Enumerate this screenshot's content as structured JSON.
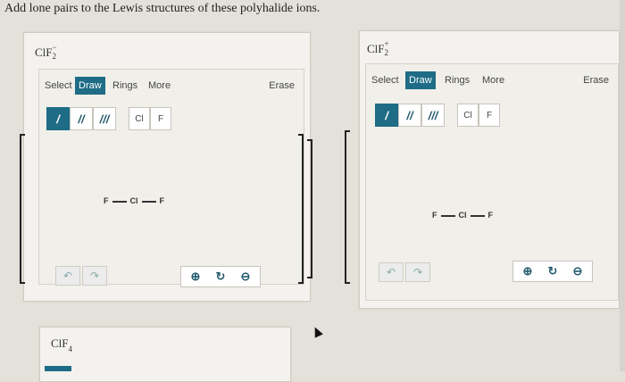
{
  "instruction": "Add lone pairs to the Lewis structures of these polyhalide ions.",
  "panels": [
    {
      "formula_base": "ClF",
      "formula_sub": "2",
      "formula_charge": "−",
      "toolbar": {
        "select": "Select",
        "draw": "Draw",
        "rings": "Rings",
        "more": "More",
        "erase": "Erase"
      },
      "bond_tools": [
        "/",
        "//",
        "///"
      ],
      "atom_tools": [
        "Cl",
        "F"
      ],
      "molecule": {
        "left": "F",
        "center": "Cl",
        "right": "F"
      }
    },
    {
      "formula_base": "ClF",
      "formula_sub": "2",
      "formula_charge": "+",
      "toolbar": {
        "select": "Select",
        "draw": "Draw",
        "rings": "Rings",
        "more": "More",
        "erase": "Erase"
      },
      "bond_tools": [
        "/",
        "//",
        "///"
      ],
      "atom_tools": [
        "Cl",
        "F"
      ],
      "molecule": {
        "left": "F",
        "center": "Cl",
        "right": "F"
      }
    },
    {
      "formula_base": "ClF",
      "formula_sub": "4"
    }
  ],
  "icons": {
    "undo": "undo-icon",
    "redo": "redo-icon",
    "zoom_in": "zoom-in-icon",
    "reset": "reset-zoom-icon",
    "zoom_out": "zoom-out-icon"
  },
  "colors": {
    "accent": "#1e6c85"
  }
}
